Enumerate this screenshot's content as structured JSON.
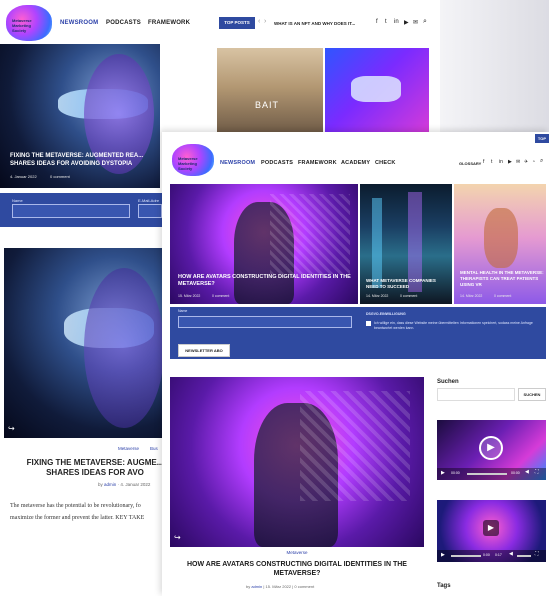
{
  "back": {
    "logo_text": "Metaverse Marketing Society",
    "nav": [
      "NEWSROOM",
      "PODCASTS",
      "FRAMEWORK"
    ],
    "top_posts": "TOP POSTS",
    "ticker": "WHAT IS AN NFT AND WHY DOES IT...",
    "hero_title": "FIXING THE METAVERSE: AUGMENTED REA... SHARES IDEAS FOR AVOIDING DYSTOPIA",
    "hero_meta": "4. Januar 2022",
    "hero_comments": "0 comment",
    "form_name": "Name",
    "form_email": "E-Mail-Adre",
    "post_category_1": "Metaverse",
    "post_category_2": "Bus",
    "post_title": "FIXING THE METAVERSE: AUGME... SHARES IDEAS FOR AVO",
    "post_by": "by",
    "post_author": "admin",
    "post_date": "4. Januar 2022",
    "post_excerpt_1": "The metaverse has the potential to be revolutionary, fo",
    "post_excerpt_2": "maximize the former and prevent the latter. KEY TAKE",
    "bait": "BAIT"
  },
  "front": {
    "logo_text": "Metaverse Marketing Society",
    "nav": [
      "NEWSROOM",
      "PODCASTS",
      "FRAMEWORK",
      "ACADEMY",
      "CHECK"
    ],
    "glossary": "GLOSSARY",
    "top_label": "TOP",
    "grid": [
      {
        "title": "HOW ARE AVATARS CONSTRUCTING DIGITAL IDENTITIES IN THE METAVERSE?",
        "date": "15. März 2022",
        "comments": "0 comment"
      },
      {
        "title": "WHAT METAVERSE COMPANIES NEED TO SUCCEED",
        "date": "14. März 2022",
        "comments": "0 comment"
      },
      {
        "title": "MENTAL HEALTH IN THE METAVERSE: THERAPISTS CAN TREAT PATIENTS USING VR",
        "date": "14. März 2022",
        "comments": "0 comment"
      }
    ],
    "form_name": "Name",
    "form_consent_title": "DSGVO-EINWILLIGUNG",
    "form_consent_text": "Ich willige ein, dass diese Website meine übermittelten Informationen speichert, sodass meine Anfrage beantwortet werden kann.",
    "newsletter_btn": "NEWSLETTER ABO",
    "main_category": "Metaverse",
    "main_title": "HOW ARE AVATARS CONSTRUCTING DIGITAL IDENTITIES IN THE METAVERSE?",
    "main_by": "by",
    "main_author": "admin",
    "main_date": "15. März 2022",
    "main_comments": "0 comment",
    "search_label": "Suchen",
    "search_btn": "SUCHEN",
    "video1_time": "00:00",
    "video1_dur": "00:00",
    "video2_time": "0:00",
    "video2_dur": "0:17",
    "tags_label": "Tags"
  }
}
